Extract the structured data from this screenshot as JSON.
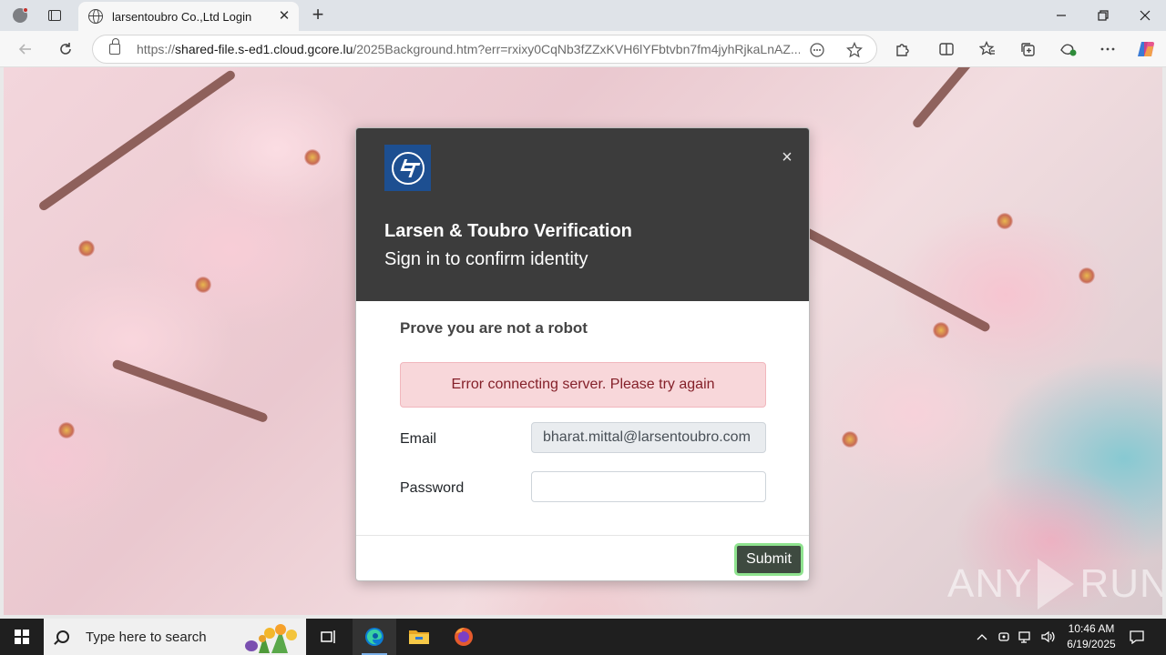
{
  "browser": {
    "tab": {
      "title": "larsentoubro Co.,Ltd Login"
    },
    "url": {
      "scheme": "https://",
      "host": "shared-file.s-ed1.cloud.gcore.lu",
      "path": "/2025Background.htm?err=rxixy0CqNb3fZZxKVH6lYFbtvbn7fm4jyhRjkaLnAZ..."
    }
  },
  "modal": {
    "title": "Larsen & Toubro Verification",
    "subtitle": "Sign in to confirm identity",
    "close_glyph": "×",
    "section_title": "Prove you are not a robot",
    "alert": "Error connecting server. Please try again",
    "email_label": "Email",
    "email_value": "bharat.mittal@larsentoubro.com",
    "password_label": "Password",
    "password_value": "",
    "submit_label": "Submit"
  },
  "watermark": {
    "left": "ANY",
    "right": "RUN"
  },
  "taskbar": {
    "search_placeholder": "Type here to search",
    "time": "10:46 AM",
    "date": "6/19/2025"
  },
  "colors": {
    "modal_header": "#3c3c3c",
    "logo_bg": "#1d4f91",
    "alert_bg": "#f8d7da",
    "alert_text": "#842029",
    "submit_bg": "#3e4a40",
    "submit_focus_ring": "#8fe38f"
  },
  "icons": [
    "profile-icon",
    "tab-actions-icon",
    "globe-icon",
    "close-icon",
    "plus-icon",
    "back-icon",
    "refresh-icon",
    "lock-icon",
    "reading-icon",
    "favorite-star-icon",
    "extensions-icon",
    "split-screen-icon",
    "favorites-icon",
    "collections-icon",
    "performance-icon",
    "more-icon",
    "copilot-icon",
    "windows-icon",
    "search-icon",
    "task-view-icon",
    "edge-icon",
    "file-explorer-icon",
    "firefox-icon",
    "chevron-up-icon",
    "network-icon",
    "volume-icon",
    "notification-icon"
  ]
}
